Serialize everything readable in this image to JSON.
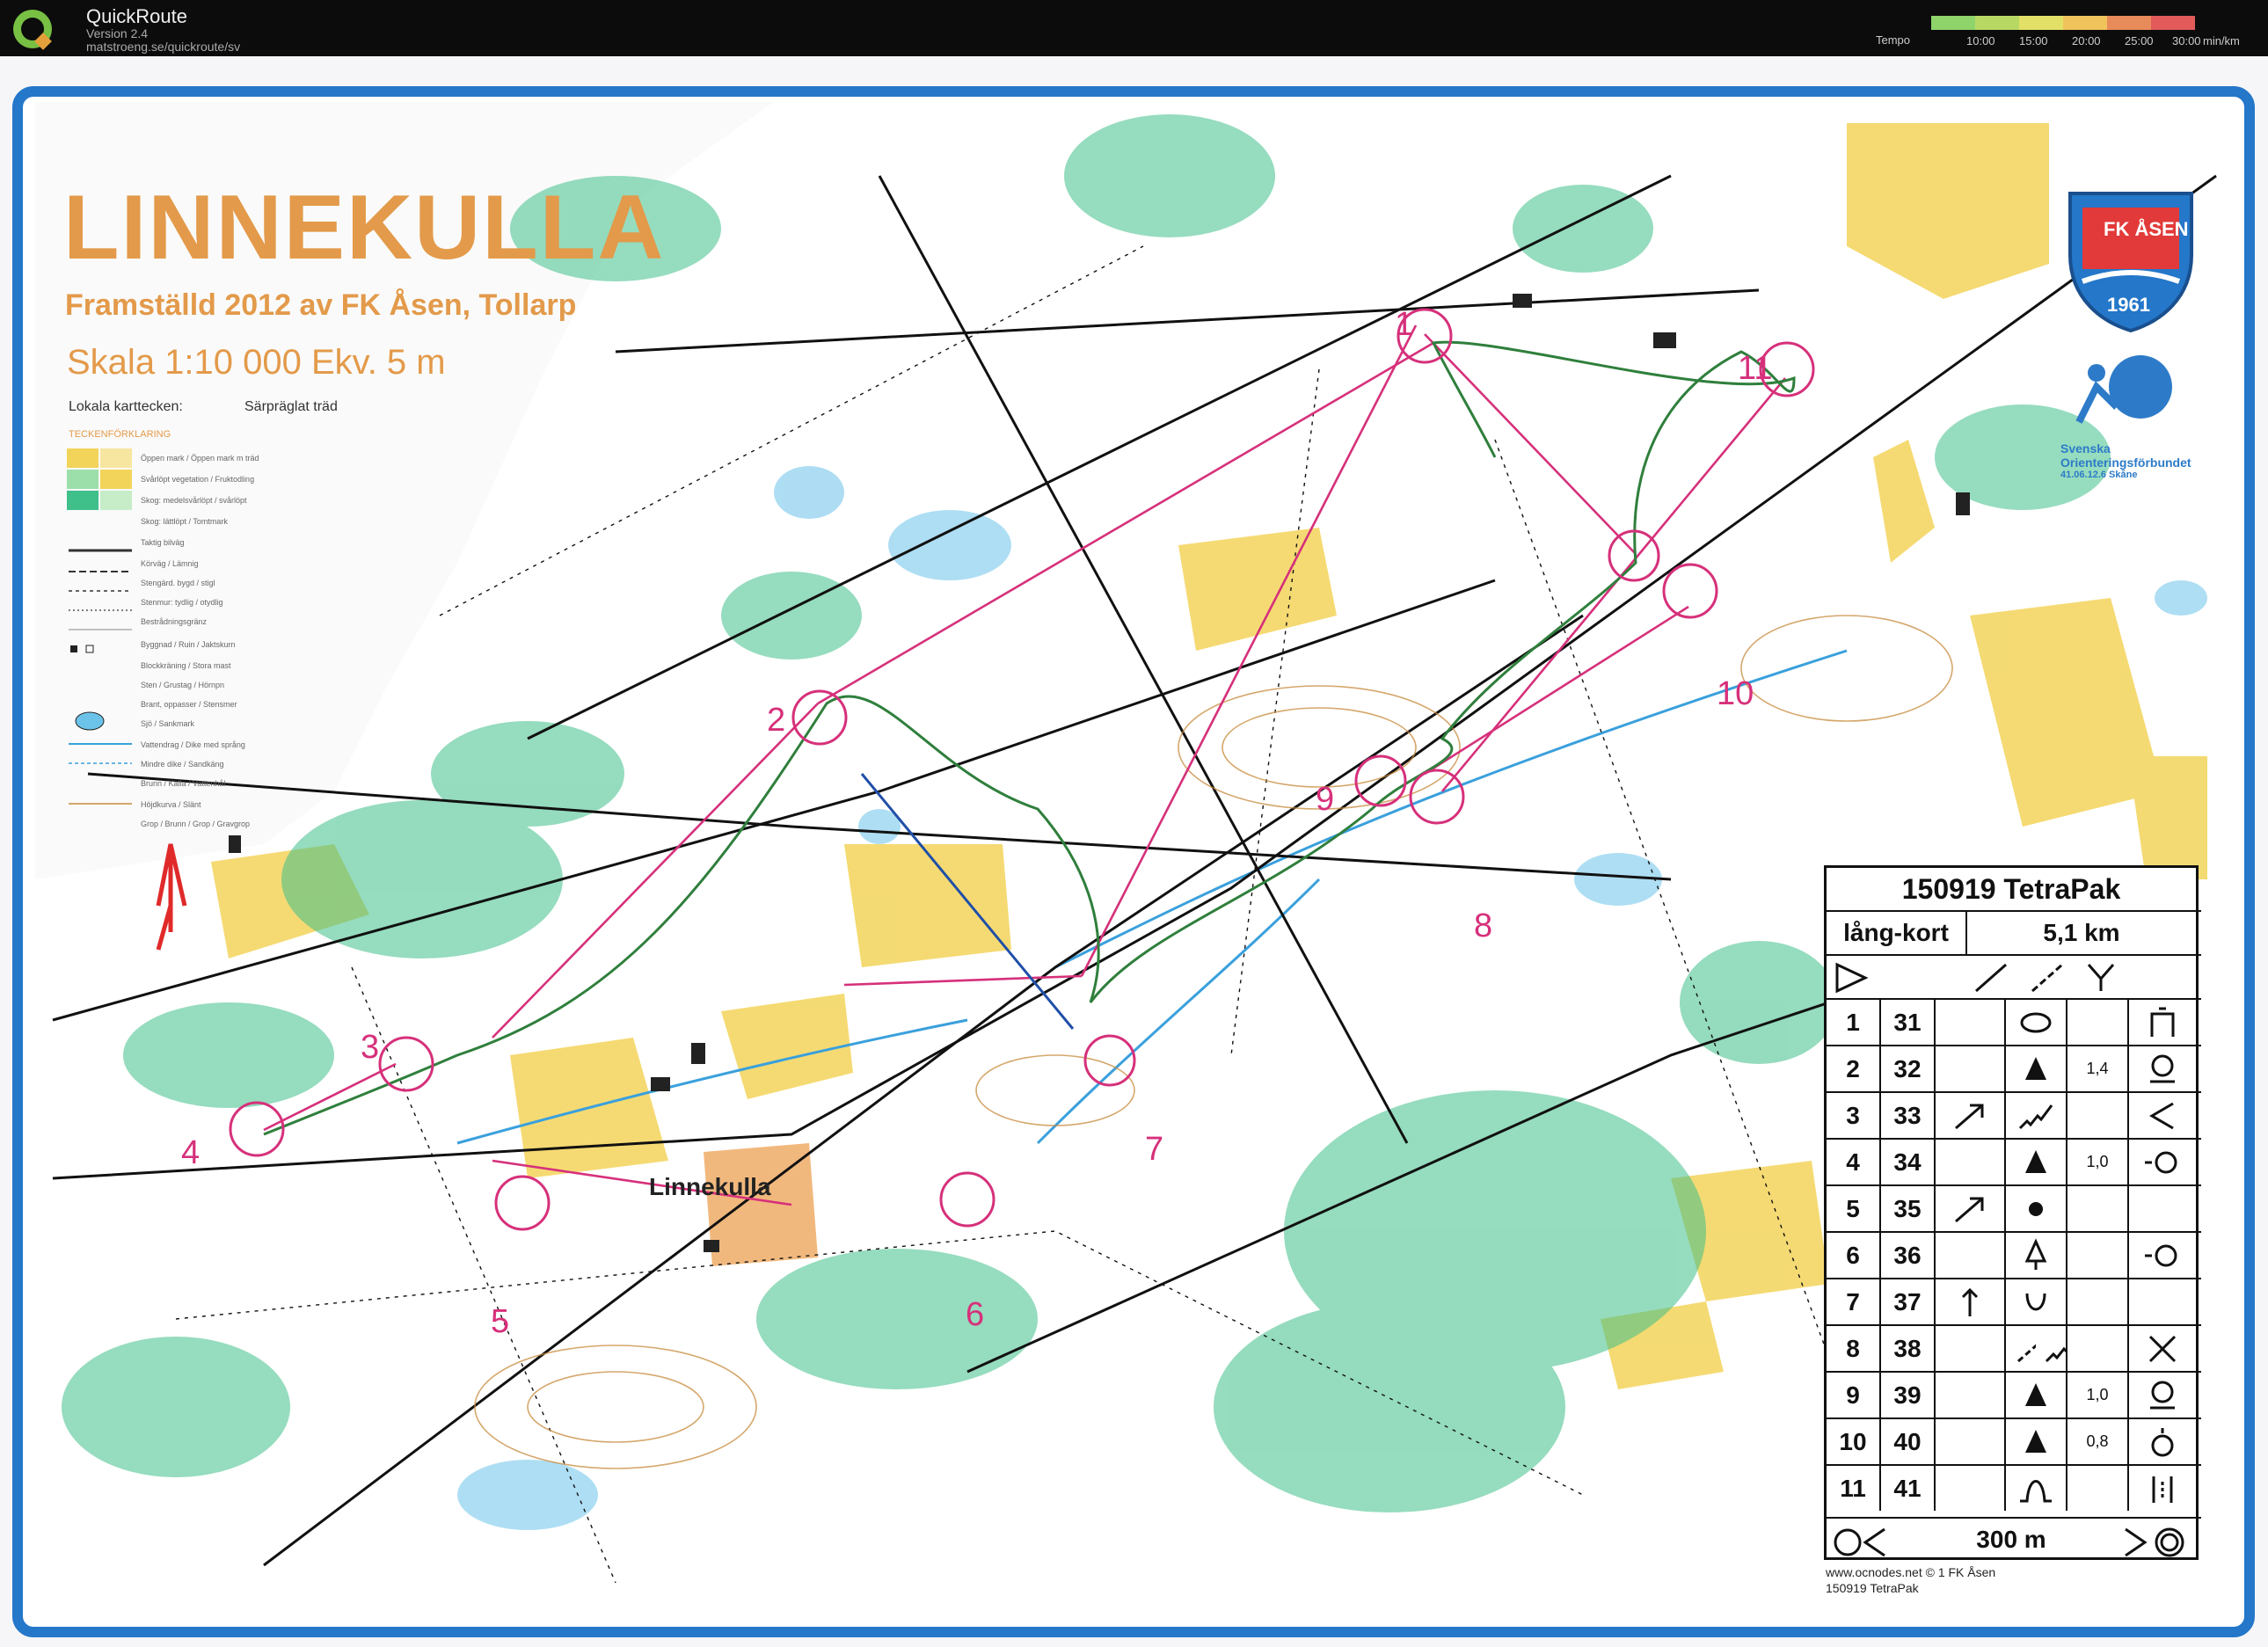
{
  "app": {
    "title": "QuickRoute",
    "version": "Version 2.4",
    "url": "matstroeng.se/quickroute/sv",
    "tempo_label": "Tempo",
    "tempo_ticks": [
      "10:00",
      "15:00",
      "20:00",
      "25:00",
      "30:00"
    ],
    "tempo_unit": "min/km",
    "tempo_colors": [
      "#8fd36b",
      "#b7d964",
      "#e3e068",
      "#f0c35c",
      "#e88b5a",
      "#e25a5a"
    ]
  },
  "map": {
    "title": "LINNEKULLA",
    "subtitle": "Framställd 2012 av FK Åsen, Tollarp",
    "scale": "Skala 1:10 000   Ekv. 5 m",
    "local_symbols_label": "Lokala karttecken:",
    "local_symbol_item": "Särpräglat träd",
    "legend_title": "TECKENFÖRKLARING",
    "legend_items": [
      "Öppen mark / Öppen mark m träd",
      "Svårlöpt vegetation / Fruktodling",
      "Skog: medelsvårlöpt / svårlöpt",
      "Skog: lättlöpt / Tomtmark",
      "Taktig bilväg",
      "Körväg / Lämnig",
      "Stengärd. bygd / stigl",
      "Stenmur: tydlig / otydlig",
      "Bestrådningsgränz",
      "Byggnad / Ruin / Jaktskurn",
      "Blockkräning / Stora mast",
      "Sten / Grustag / Hörnpn",
      "Brant, oppasser / Stensmer",
      "Sjö / Sankmark",
      "Vattendrag / Dike med språng",
      "Mindre dike / Sandkäng",
      "Brunn / Källa / Vattenhål",
      "Höjdkurva / Slänt",
      "Grop / Brunn / Grop / Gravgrop"
    ],
    "village_label": "Linnekulla",
    "control_numbers": [
      "1",
      "2",
      "3",
      "4",
      "5",
      "6",
      "7",
      "8",
      "9",
      "10",
      "11"
    ],
    "colors": {
      "control": "#d6307b",
      "route": "#2f7f3c",
      "frame": "#2477c9",
      "title": "#e39a4a",
      "forest": "#3fbf8a",
      "open": "#f3d45a",
      "water": "#6cc3ea"
    }
  },
  "club": {
    "name": "FK ÅSEN",
    "year": "1961",
    "federation_line1": "Svenska",
    "federation_line2": "Orienteringsförbundet",
    "federation_line3": "41.06.12.6 Skåne"
  },
  "description": {
    "event": "150919 TetraPak",
    "class": "lång-kort",
    "length": "5,1 km",
    "rows": [
      {
        "num": "1",
        "code": "31",
        "dir": "",
        "feature": "ellipse",
        "detail": "",
        "dim": "",
        "loc": "gate"
      },
      {
        "num": "2",
        "code": "32",
        "dir": "",
        "feature": "triangle",
        "detail": "",
        "dim": "1,4",
        "loc": "foot"
      },
      {
        "num": "3",
        "code": "33",
        "dir": "arrow-ne",
        "feature": "wavy",
        "detail": "",
        "dim": "",
        "loc": "less"
      },
      {
        "num": "4",
        "code": "34",
        "dir": "",
        "feature": "triangle",
        "detail": "",
        "dim": "1,0",
        "loc": "circle-side"
      },
      {
        "num": "5",
        "code": "35",
        "dir": "arrow-ne",
        "feature": "dot",
        "detail": "",
        "dim": "",
        "loc": ""
      },
      {
        "num": "6",
        "code": "36",
        "dir": "",
        "feature": "tree",
        "detail": "",
        "dim": "",
        "loc": "circle-side"
      },
      {
        "num": "7",
        "code": "37",
        "dir": "arrow-up",
        "feature": "cup",
        "detail": "",
        "dim": "",
        "loc": ""
      },
      {
        "num": "8",
        "code": "38",
        "dir": "",
        "feature": "slash",
        "detail": "wavy",
        "dim": "",
        "loc": "cross"
      },
      {
        "num": "9",
        "code": "39",
        "dir": "",
        "feature": "triangle",
        "detail": "",
        "dim": "1,0",
        "loc": "foot"
      },
      {
        "num": "10",
        "code": "40",
        "dir": "",
        "feature": "triangle",
        "detail": "",
        "dim": "0,8",
        "loc": "top"
      },
      {
        "num": "11",
        "code": "41",
        "dir": "",
        "feature": "bump",
        "detail": "",
        "dim": "",
        "loc": "bars"
      }
    ],
    "finish_distance": "300 m",
    "credits_line1": "www.ocnodes.net © 1 FK Åsen",
    "credits_line2": "150919 TetraPak"
  }
}
